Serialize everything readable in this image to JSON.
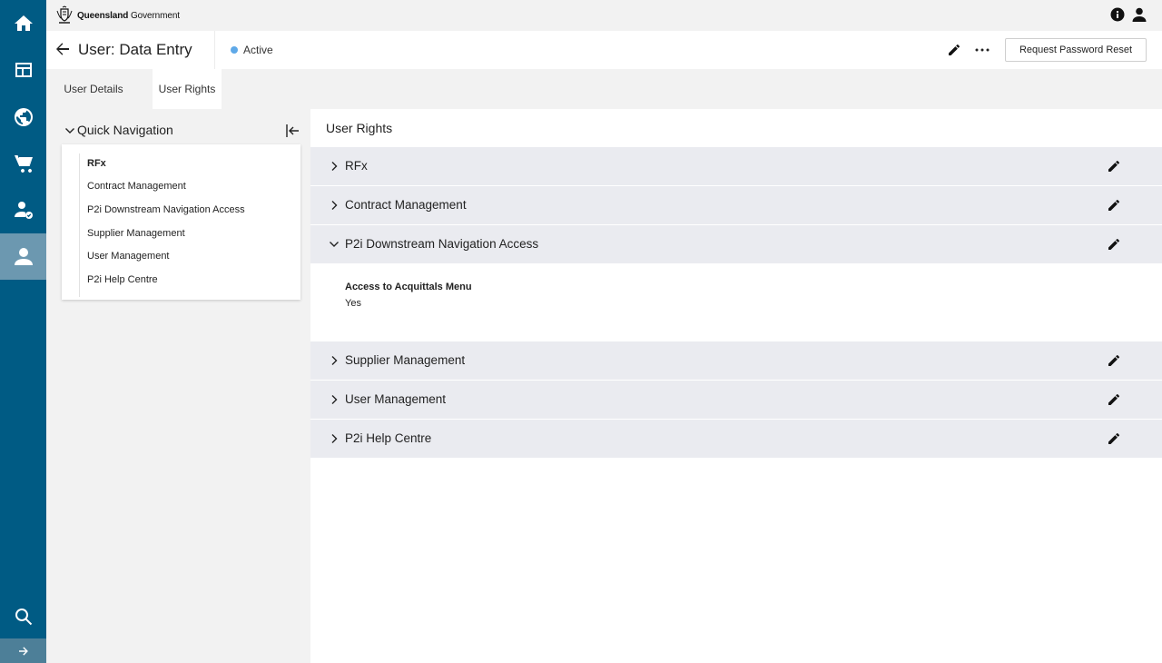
{
  "rail": {
    "items": [
      {
        "icon": "home-icon"
      },
      {
        "icon": "dashboard-icon"
      },
      {
        "icon": "globe-icon"
      },
      {
        "icon": "cart-icon"
      },
      {
        "icon": "user-check-icon"
      },
      {
        "icon": "user-icon",
        "active": true
      }
    ],
    "search_icon": "search-icon",
    "expand_icon": "arrow-right-icon"
  },
  "topbar": {
    "brand_bold": "Queensland",
    "brand_rest": "Government",
    "icons": [
      "info-icon",
      "account-icon"
    ]
  },
  "header": {
    "title": "User: Data Entry",
    "status": "Active",
    "status_color": "#5fa9e8",
    "reset_label": "Request Password Reset"
  },
  "tabs": [
    {
      "label": "User Details",
      "active": false
    },
    {
      "label": "User Rights",
      "active": true
    }
  ],
  "quick_nav": {
    "title": "Quick Navigation",
    "items": [
      {
        "label": "RFx",
        "active": true
      },
      {
        "label": "Contract Management"
      },
      {
        "label": "P2i Downstream Navigation Access"
      },
      {
        "label": "Supplier Management"
      },
      {
        "label": "User Management"
      },
      {
        "label": "P2i Help Centre"
      }
    ]
  },
  "main": {
    "title": "User Rights",
    "sections": [
      {
        "label": "RFx",
        "expanded": false
      },
      {
        "label": "Contract Management",
        "expanded": false
      },
      {
        "label": "P2i Downstream Navigation Access",
        "expanded": true
      },
      {
        "label": "Supplier Management",
        "expanded": false
      },
      {
        "label": "User Management",
        "expanded": false
      },
      {
        "label": "P2i Help Centre",
        "expanded": false
      }
    ],
    "expanded_field": {
      "label": "Access to Acquittals Menu",
      "value": "Yes"
    }
  },
  "colors": {
    "rail_bg": "#005b84",
    "rail_active": "#6c98b0",
    "section_bg": "#eaebf0"
  }
}
